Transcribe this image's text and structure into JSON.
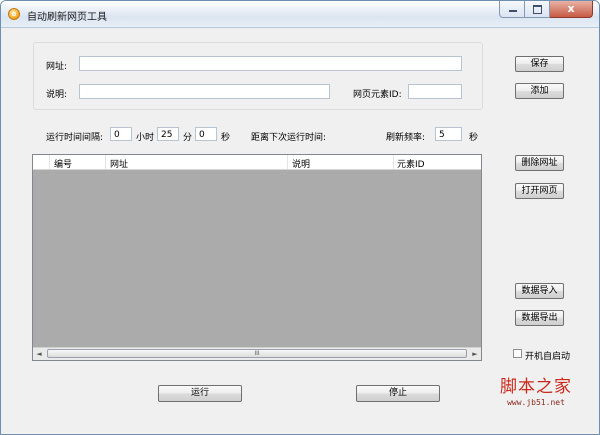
{
  "window": {
    "title": "自动刷新网页工具",
    "close_glyph": "x"
  },
  "form": {
    "url_label": "网址:",
    "url_value": "",
    "desc_label": "说明:",
    "desc_value": "",
    "element_id_label": "网页元素ID:",
    "element_id_value": ""
  },
  "buttons": {
    "save": "保存",
    "add": "添加",
    "delete_url": "删除网址",
    "open_page": "打开网页",
    "import_data": "数据导入",
    "export_data": "数据导出",
    "run": "运行",
    "stop": "停止"
  },
  "timer": {
    "interval_label": "运行时间间隔:",
    "hours_value": "0",
    "hours_unit": "小时",
    "minutes_value": "25",
    "minutes_unit": "分",
    "seconds_value": "0",
    "seconds_unit": "秒",
    "next_run_label": "距离下次运行时间:",
    "next_run_value": "",
    "refresh_freq_label": "刷新频率:",
    "refresh_freq_value": "5",
    "refresh_freq_unit": "秒"
  },
  "list": {
    "columns": [
      "编号",
      "网址",
      "说明",
      "元素ID"
    ],
    "rows": [],
    "scroll_grip": "III",
    "scroll_left": "◄",
    "scroll_right": "►"
  },
  "autostart": {
    "label": "开机自启动",
    "checked": false
  },
  "watermark": {
    "text": "脚本之家",
    "url": "www.jb51.net"
  },
  "colors": {
    "list_bg": "#ababab",
    "watermark": "#cc2a1c"
  }
}
